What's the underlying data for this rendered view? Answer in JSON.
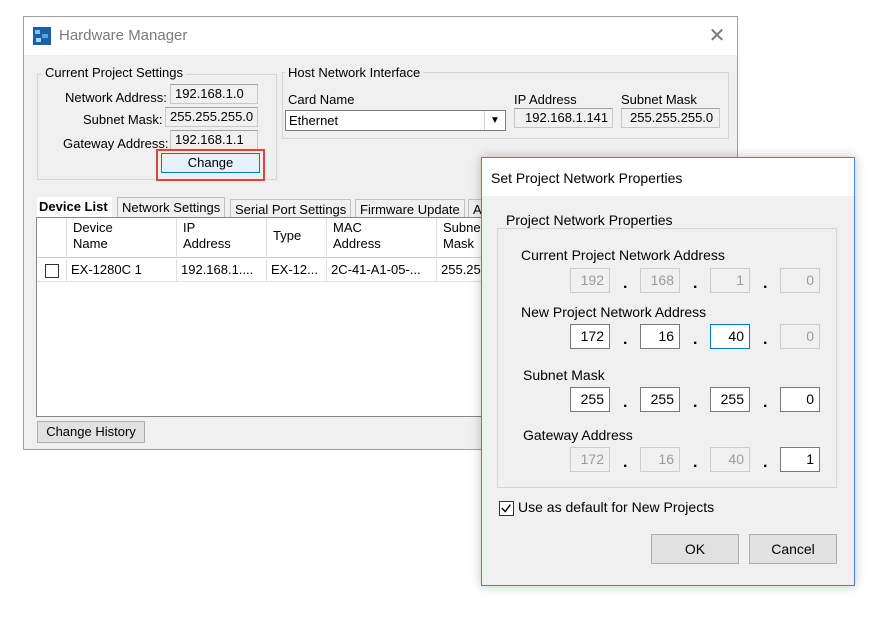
{
  "hardware_manager": {
    "title": "Hardware Manager",
    "close_glyph": "✕",
    "project_settings": {
      "title": "Current Project Settings",
      "network_address_label": "Network Address:",
      "network_address": "192.168.1.0",
      "subnet_mask_label": "Subnet Mask:",
      "subnet_mask": "255.255.255.0",
      "gateway_address_label": "Gateway Address:",
      "gateway_address": "192.168.1.1",
      "change_button": "Change"
    },
    "host_interface": {
      "title": "Host Network Interface",
      "card_name_label": "Card Name",
      "card_name": "Ethernet",
      "ip_address_label": "IP Address",
      "ip_address": "192.168.1.141",
      "subnet_mask_label": "Subnet Mask",
      "subnet_mask": "255.255.255.0"
    },
    "tabs": [
      "Device List",
      "Network Settings",
      "Serial Port Settings",
      "Firmware Update",
      "A"
    ],
    "device_table": {
      "headers": [
        "Device Name",
        "IP Address",
        "Type",
        "MAC Address",
        "Subnet Mask"
      ],
      "header_lines": [
        [
          "Device",
          "Name"
        ],
        [
          "IP",
          "Address"
        ],
        [
          "Type",
          ""
        ],
        [
          "MAC",
          "Address"
        ],
        [
          "Subne",
          "Mask"
        ]
      ],
      "rows": [
        {
          "checked": false,
          "device_name": "EX-1280C 1",
          "ip_address": "192.168.1....",
          "type": "EX-12...",
          "mac_address": "2C-41-A1-05-...",
          "subnet_mask": "255.25"
        }
      ]
    },
    "change_history_button": "Change History"
  },
  "dialog": {
    "title": "Set Project Network Properties",
    "group_title": "Project Network Properties",
    "current_label": "Current Project Network Address",
    "current": [
      "192",
      "168",
      "1",
      "0"
    ],
    "new_label": "New Project Network Address",
    "new": [
      "172",
      "16",
      "40",
      "0"
    ],
    "subnet_label": "Subnet Mask",
    "subnet": [
      "255",
      "255",
      "255",
      "0"
    ],
    "gateway_label": "Gateway Address",
    "gateway": [
      "172",
      "16",
      "40",
      "1"
    ],
    "default_checkbox_label": "Use as default for New Projects",
    "default_checked": true,
    "ok_button": "OK",
    "cancel_button": "Cancel",
    "dot": "."
  },
  "colors": {
    "highlight": "#e34234",
    "accent": "#0078d7"
  }
}
